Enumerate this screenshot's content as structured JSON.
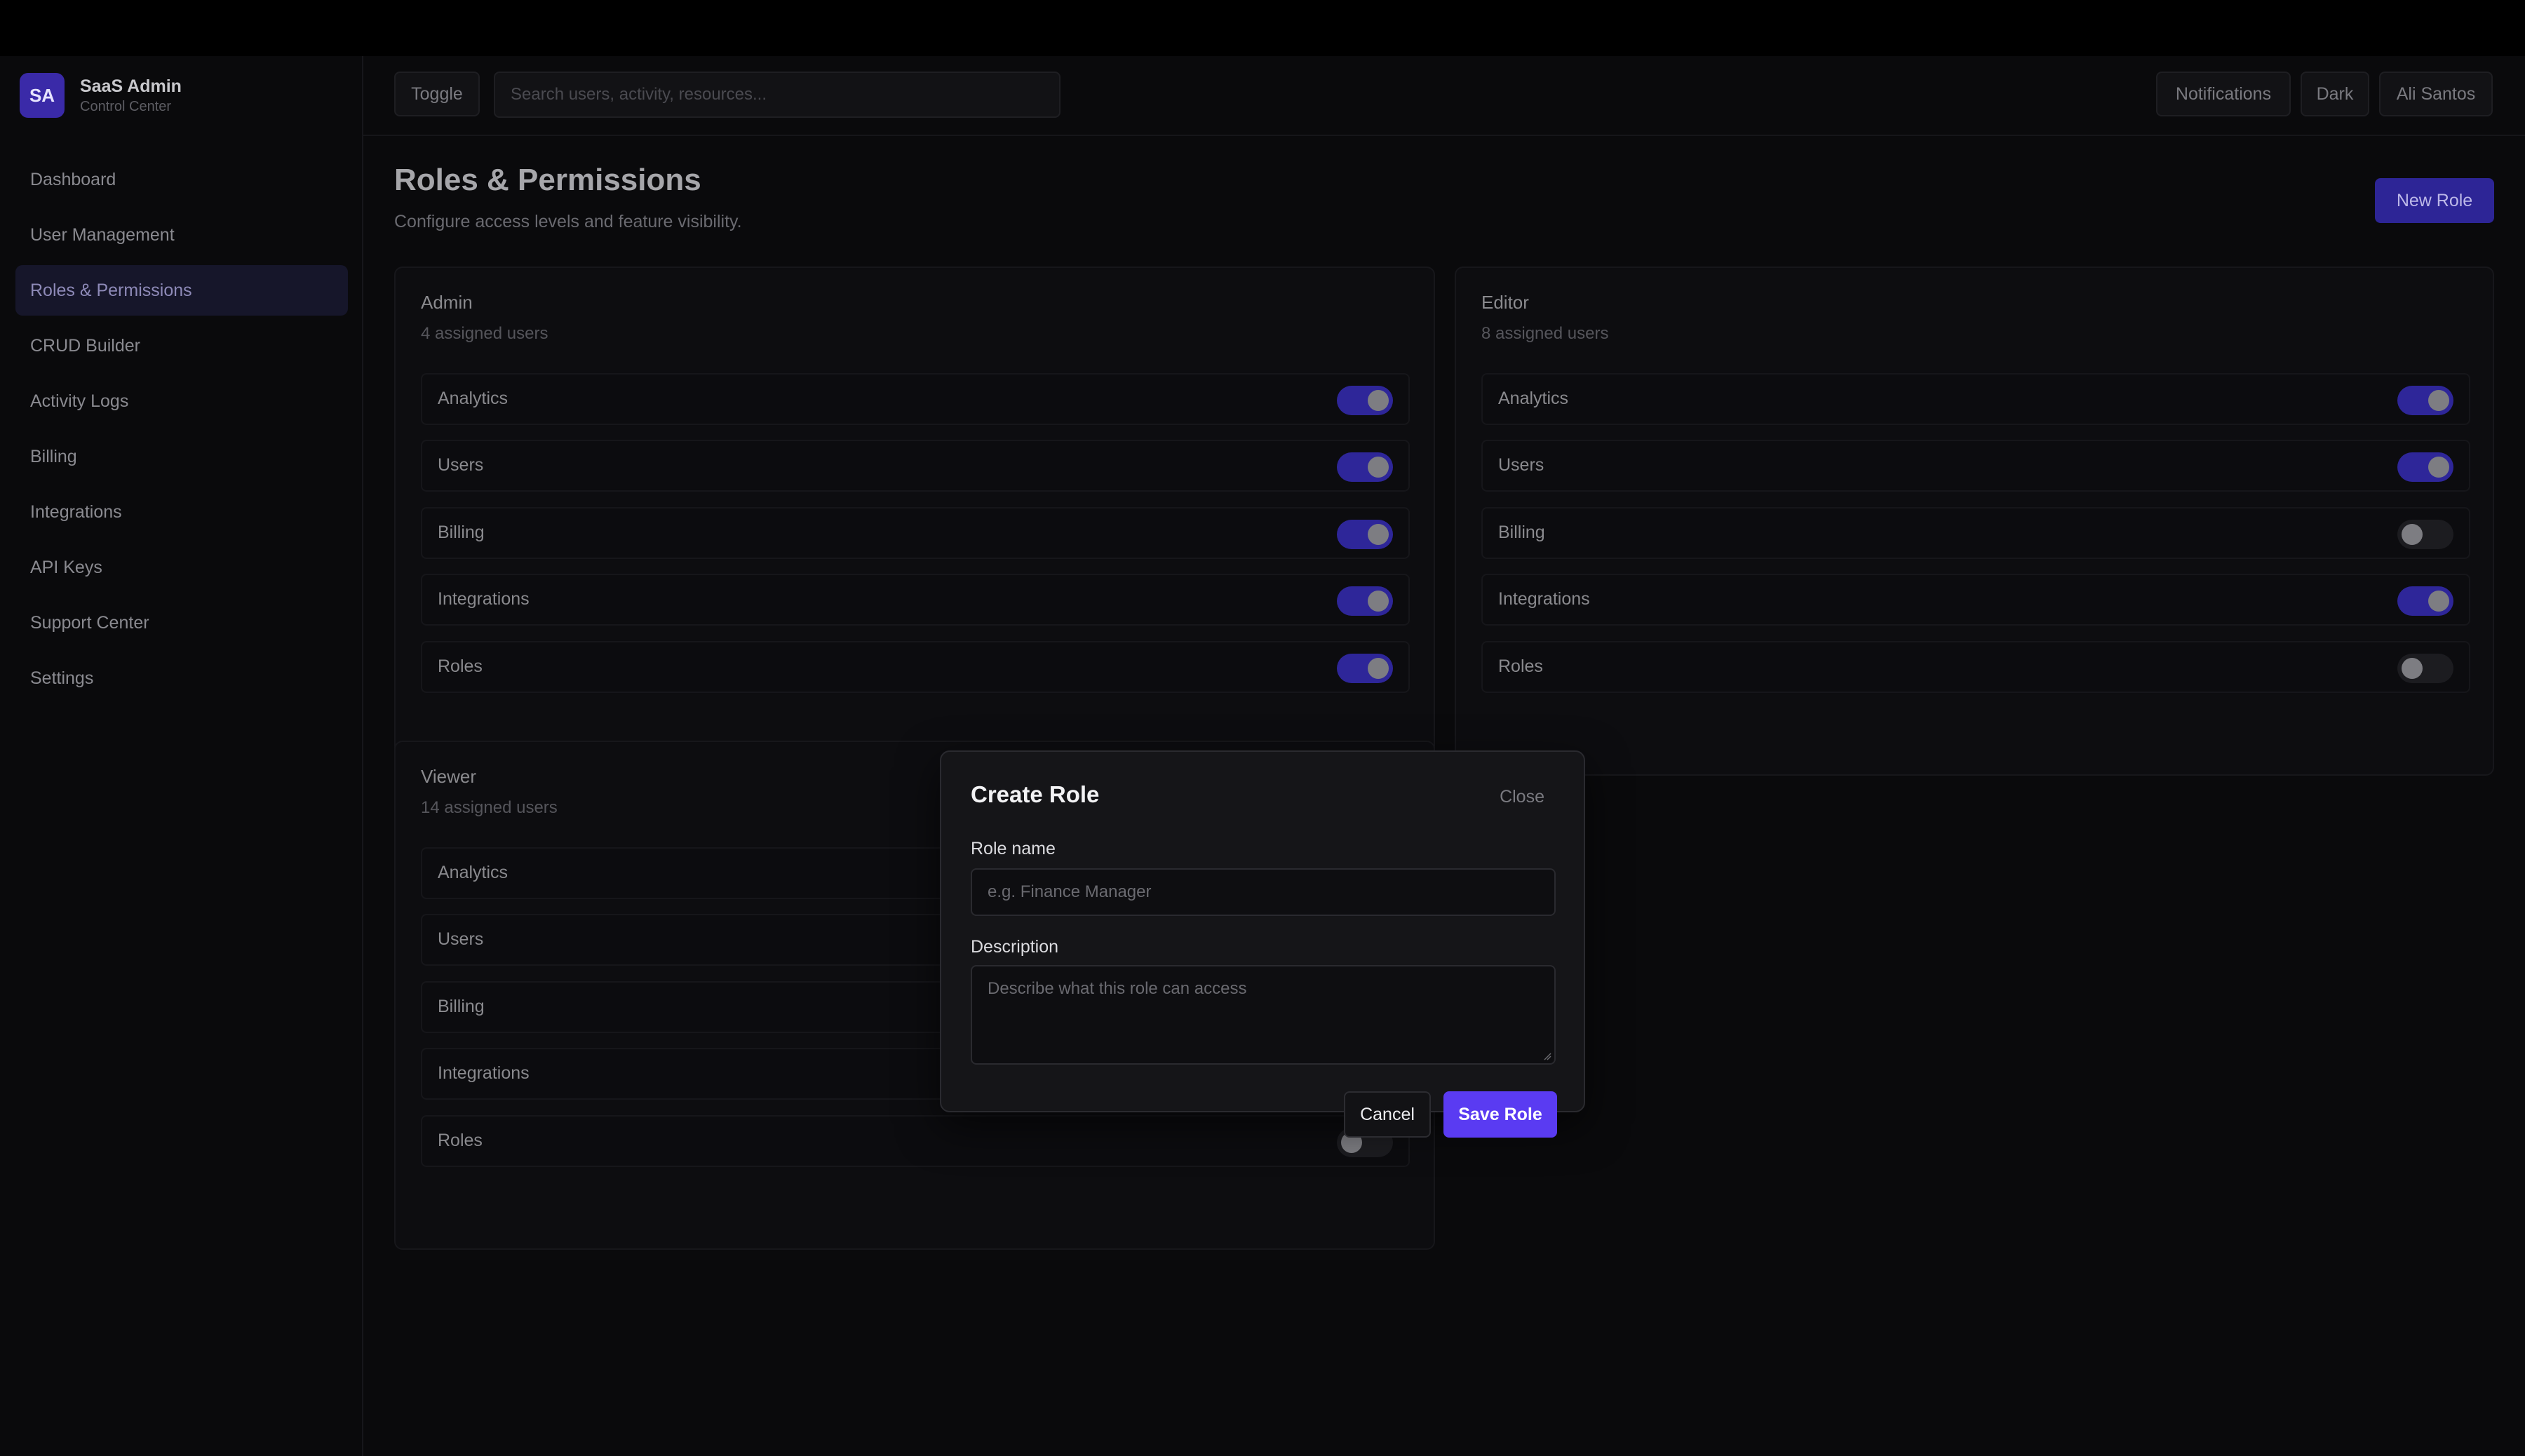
{
  "brand": {
    "initials": "SA",
    "title": "SaaS Admin",
    "subtitle": "Control Center"
  },
  "sidebar": {
    "items": [
      {
        "label": "Dashboard",
        "active": false
      },
      {
        "label": "User Management",
        "active": false
      },
      {
        "label": "Roles & Permissions",
        "active": true
      },
      {
        "label": "CRUD Builder",
        "active": false
      },
      {
        "label": "Activity Logs",
        "active": false
      },
      {
        "label": "Billing",
        "active": false
      },
      {
        "label": "Integrations",
        "active": false
      },
      {
        "label": "API Keys",
        "active": false
      },
      {
        "label": "Support Center",
        "active": false
      },
      {
        "label": "Settings",
        "active": false
      }
    ]
  },
  "header": {
    "toggle_label": "Toggle",
    "search_placeholder": "Search users, activity, resources...",
    "notifications_label": "Notifications",
    "theme_label": "Dark",
    "user_label": "Ali Santos"
  },
  "page": {
    "title": "Roles & Permissions",
    "subtitle": "Configure access levels and feature visibility.",
    "new_role_label": "New Role"
  },
  "roles": [
    {
      "name": "Admin",
      "users": "4 assigned users",
      "permissions": [
        {
          "label": "Analytics",
          "enabled": true
        },
        {
          "label": "Users",
          "enabled": true
        },
        {
          "label": "Billing",
          "enabled": true
        },
        {
          "label": "Integrations",
          "enabled": true
        },
        {
          "label": "Roles",
          "enabled": true
        }
      ]
    },
    {
      "name": "Editor",
      "users": "8 assigned users",
      "permissions": [
        {
          "label": "Analytics",
          "enabled": true
        },
        {
          "label": "Users",
          "enabled": true
        },
        {
          "label": "Billing",
          "enabled": false
        },
        {
          "label": "Integrations",
          "enabled": true
        },
        {
          "label": "Roles",
          "enabled": false
        }
      ]
    },
    {
      "name": "Viewer",
      "users": "14 assigned users",
      "permissions": [
        {
          "label": "Analytics",
          "enabled": true
        },
        {
          "label": "Users",
          "enabled": false
        },
        {
          "label": "Billing",
          "enabled": false
        },
        {
          "label": "Integrations",
          "enabled": false
        },
        {
          "label": "Roles",
          "enabled": false
        }
      ]
    }
  ],
  "modal": {
    "title": "Create Role",
    "close_label": "Close",
    "role_name_label": "Role name",
    "role_name_placeholder": "e.g. Finance Manager",
    "description_label": "Description",
    "description_placeholder": "Describe what this role can access",
    "cancel_label": "Cancel",
    "save_label": "Save Role"
  },
  "colors": {
    "accent": "#5a3bf2",
    "accent_dim": "#2e2699",
    "background": "#0a0a0c"
  }
}
